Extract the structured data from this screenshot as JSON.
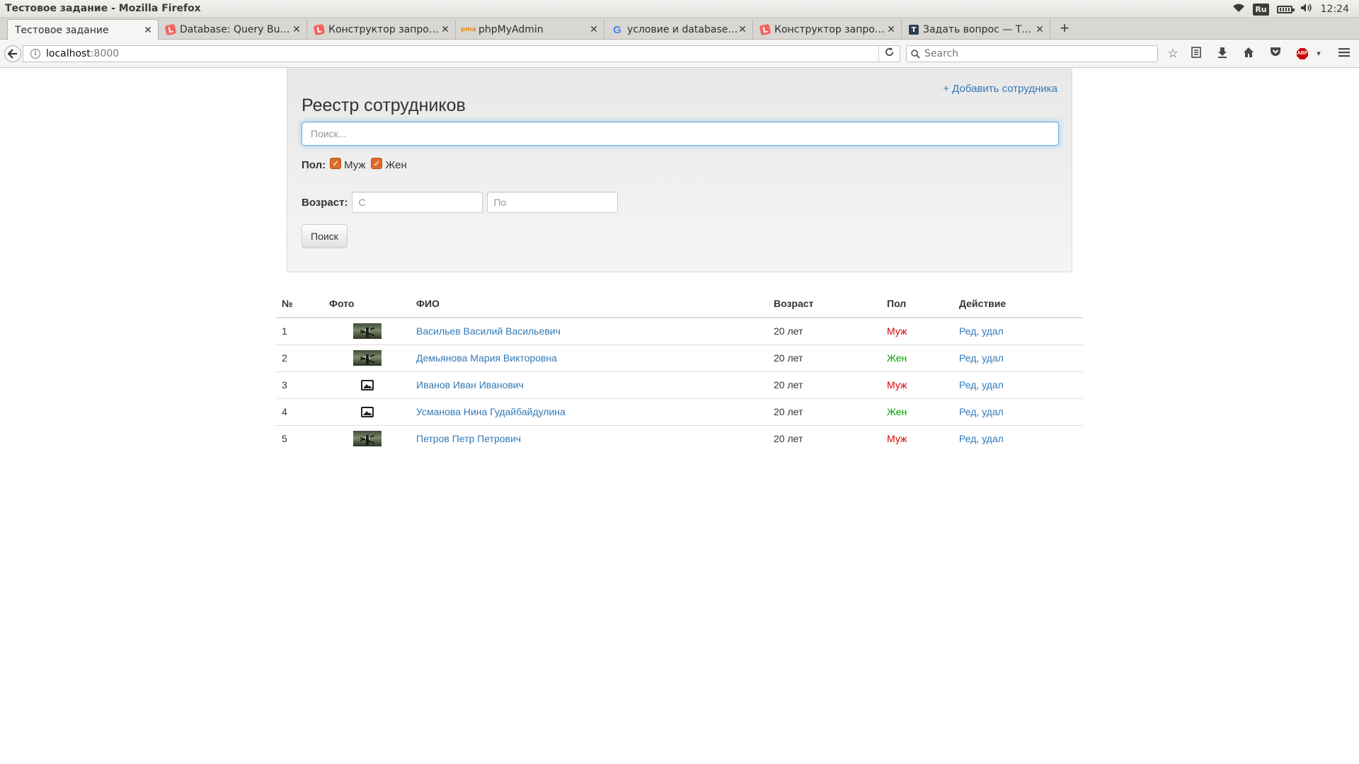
{
  "window": {
    "title": "Тестовое задание - Mozilla Firefox",
    "tray": {
      "keyboard_layout": "Ru",
      "clock": "12:24"
    }
  },
  "tabs": [
    {
      "label": "Тестовое задание",
      "icon": "none",
      "active": true
    },
    {
      "label": "Database: Query Bu…",
      "icon": "laravel-icon",
      "active": false
    },
    {
      "label": "Конструктор запро…",
      "icon": "laravel-icon",
      "active": false
    },
    {
      "label": "phpMyAdmin",
      "icon": "phpmyadmin-icon",
      "active": false
    },
    {
      "label": "условие и database…",
      "icon": "google-icon",
      "active": false
    },
    {
      "label": "Конструктор запро…",
      "icon": "laravel-icon",
      "active": false
    },
    {
      "label": "Задать вопрос — T…",
      "icon": "toster-icon",
      "active": false
    }
  ],
  "navbar": {
    "url_host": "localhost",
    "url_port": ":8000",
    "search_placeholder": "Search"
  },
  "panel": {
    "add_link": "+ Добавить сотрудника",
    "title": "Реестр сотрудников",
    "search_placeholder": "Поиск...",
    "gender_label": "Пол:",
    "gender_options": [
      {
        "label": "Муж",
        "checked": true
      },
      {
        "label": "Жен",
        "checked": true
      }
    ],
    "age_label": "Возраст:",
    "age_from_placeholder": "С",
    "age_to_placeholder": "По",
    "search_button": "Поиск"
  },
  "table": {
    "headers": [
      "№",
      "Фото",
      "ФИО",
      "Возраст",
      "Пол",
      "Действие"
    ],
    "rows": [
      {
        "num": "1",
        "photo": "thumbnail",
        "name": "Васильев Василий Васильевич",
        "age": "20 лет",
        "sex": "Муж",
        "sex_color": "#e00000",
        "action": "Ред, удал"
      },
      {
        "num": "2",
        "photo": "thumbnail",
        "name": "Демьянова Мария Викторовна",
        "age": "20 лет",
        "sex": "Жен",
        "sex_color": "#00a000",
        "action": "Ред, удал"
      },
      {
        "num": "3",
        "photo": "image-placeholder-icon",
        "name": "Иванов Иван Иванович",
        "age": "20 лет",
        "sex": "Муж",
        "sex_color": "#e00000",
        "action": "Ред, удал"
      },
      {
        "num": "4",
        "photo": "image-placeholder-icon",
        "name": "Усманова Нина Гудайбайдулина",
        "age": "20 лет",
        "sex": "Жен",
        "sex_color": "#00a000",
        "action": "Ред, удал"
      },
      {
        "num": "5",
        "photo": "thumbnail",
        "name": "Петров Петр Петрович",
        "age": "20 лет",
        "sex": "Муж",
        "sex_color": "#e00000",
        "action": "Ред, удал"
      }
    ]
  },
  "colors": {
    "link": "#337ab7",
    "male": "#e00000",
    "female": "#00a000",
    "checkbox": "#dd6b2c"
  }
}
